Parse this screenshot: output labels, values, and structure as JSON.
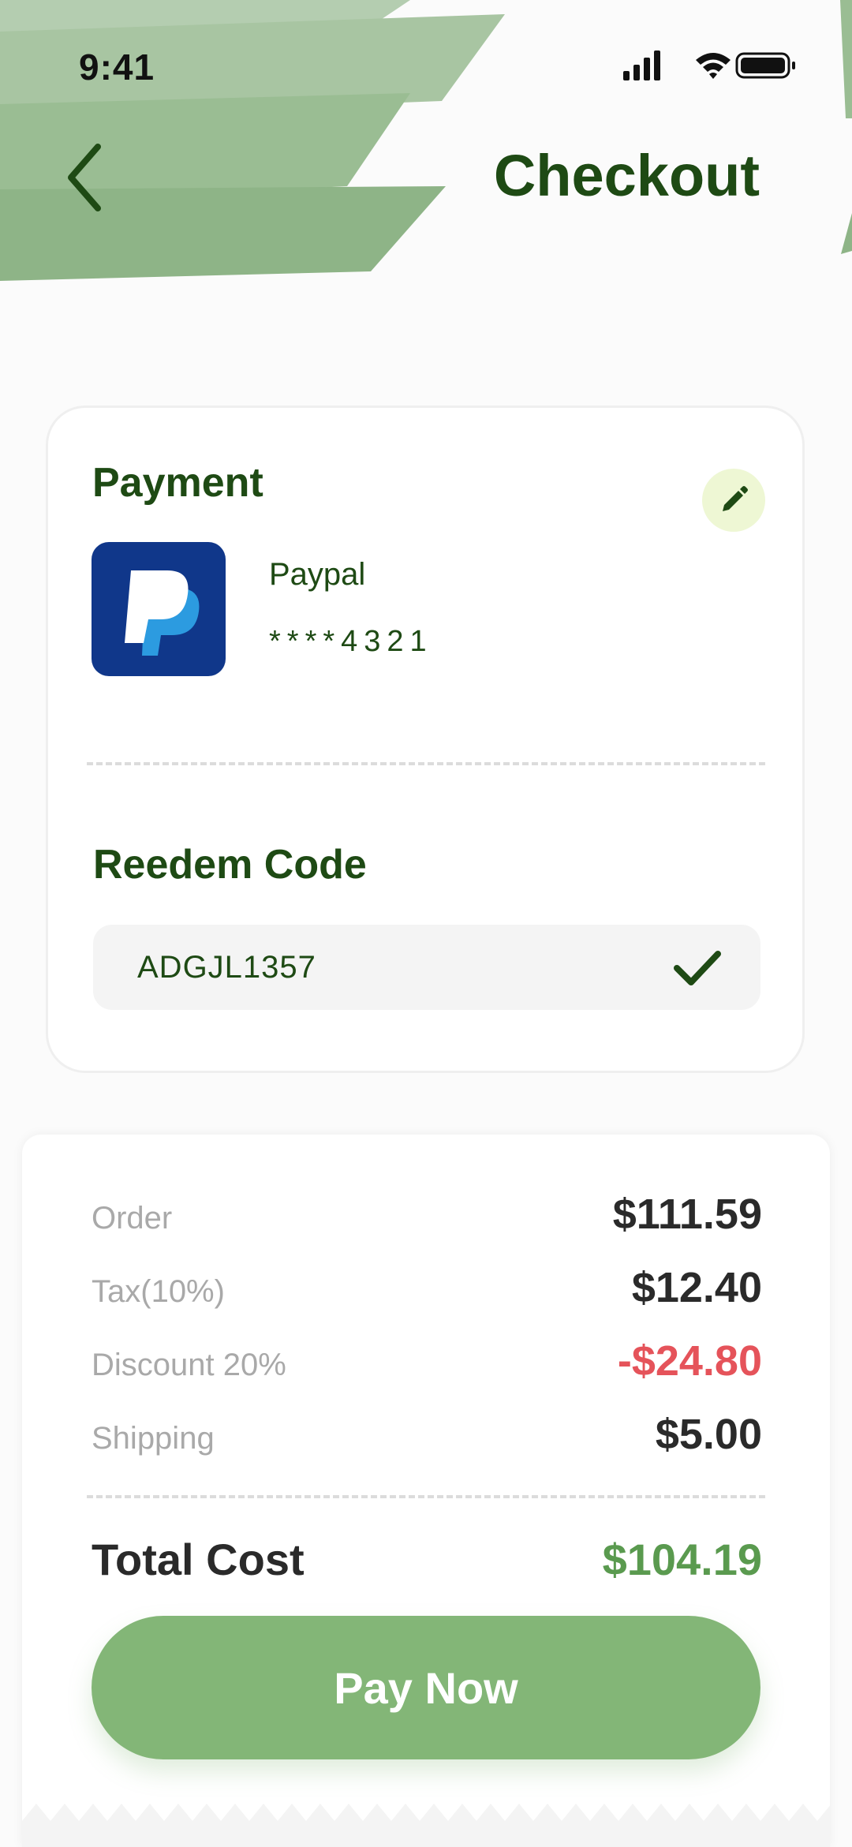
{
  "status_bar": {
    "time": "9:41"
  },
  "header": {
    "title": "Checkout"
  },
  "payment": {
    "title": "Payment",
    "method_name": "Paypal",
    "card_number": "****4321"
  },
  "redeem": {
    "title": "Reedem Code",
    "code": "ADGJL1357"
  },
  "summary": {
    "rows": [
      {
        "label": "Order",
        "value": "$111.59"
      },
      {
        "label": "Tax(10%)",
        "value": "$12.40"
      },
      {
        "label": "Discount 20%",
        "value": "-$24.80"
      },
      {
        "label": "Shipping",
        "value": "$5.00"
      }
    ],
    "total_label": "Total Cost",
    "total_value": "$104.19"
  },
  "actions": {
    "pay_label": "Pay Now"
  },
  "colors": {
    "primary_dark_green": "#1e4a14",
    "button_green": "#83b677",
    "total_green": "#5a9a4f",
    "discount_red": "#e5535a",
    "leaf_green": "#8bb382",
    "paypal_blue": "#10378a"
  },
  "icons": {
    "back": "chevron-left-icon",
    "edit": "pencil-icon",
    "paypal": "paypal-logo",
    "confirm": "check-icon",
    "signal": "cellular-signal-icon",
    "wifi": "wifi-icon",
    "battery": "battery-icon"
  }
}
